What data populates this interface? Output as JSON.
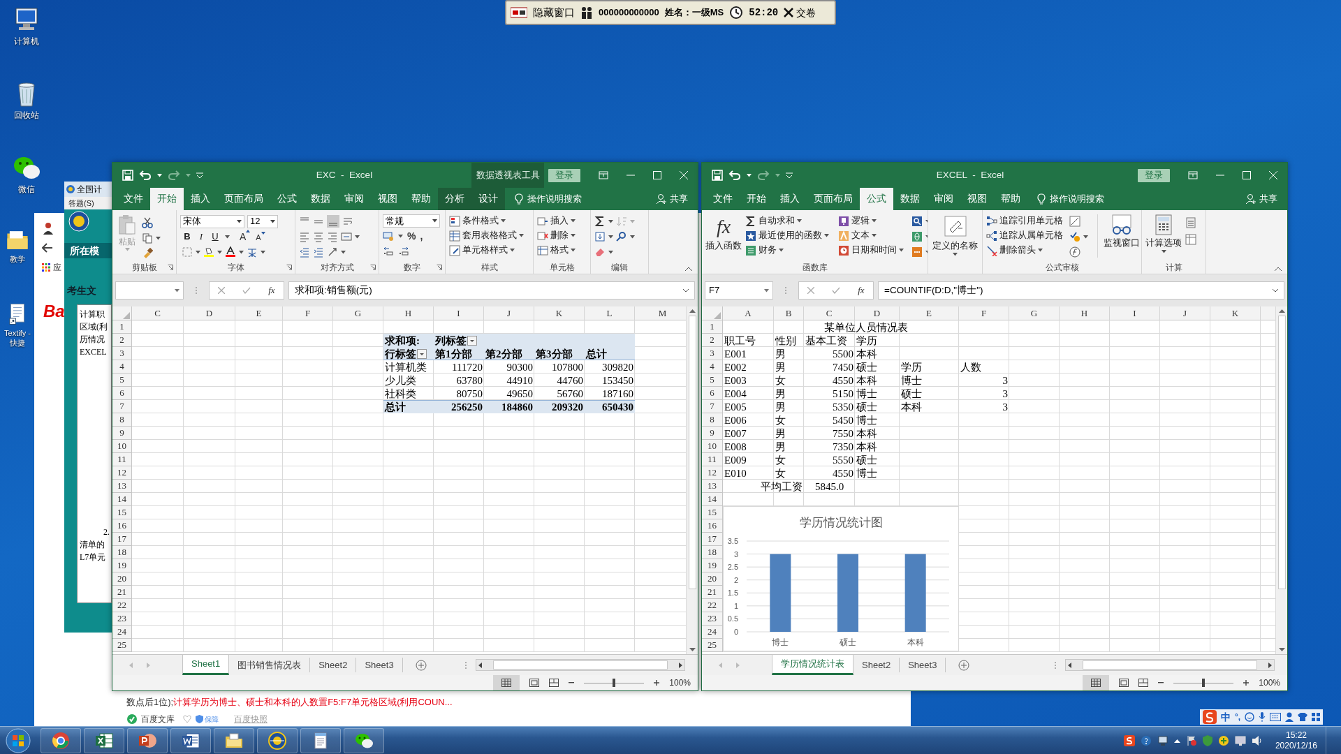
{
  "exam_bar": {
    "hide_window": "隐藏窗口",
    "exam_id": "000000000000",
    "candidate": "姓名：一级MS",
    "timer": "52:20",
    "submit": "交卷"
  },
  "desktop_icons": [
    {
      "kind": "computer",
      "label": "计算机"
    },
    {
      "kind": "recycle_bin",
      "label": "回收站"
    },
    {
      "kind": "wechat",
      "label": "微信"
    },
    {
      "kind": "folder",
      "label": "教学"
    },
    {
      "kind": "document",
      "label": "Textify - 快捷"
    }
  ],
  "browser": {
    "app_label": "应",
    "logo": "Ba",
    "note_prefix": "数点后1位);",
    "note_highlight": "计算学历为博士、硕士和本科的人数置F5:F7单元格区域(利用COUN...",
    "source": "百度文库",
    "badge": "保障",
    "snapshot": "百度快照"
  },
  "exam_window": {
    "title": "全国计",
    "menu": "答题(S)",
    "module": "所在模",
    "folder_label": "考生文",
    "lines": [
      "计算职",
      "区域(利",
      "历情况",
      "EXCEL"
    ],
    "item_number": "2.",
    "lines_2": [
      "清单的",
      "L7单元"
    ]
  },
  "excel_windows": [
    {
      "title": "EXC  -  Excel",
      "context_title": "数据透视表工具",
      "login": "登录",
      "tabs": [
        {
          "label": "文件",
          "selected": false,
          "contextual": false
        },
        {
          "label": "开始",
          "selected": true,
          "contextual": false
        },
        {
          "label": "插入",
          "selected": false,
          "contextual": false
        },
        {
          "label": "页面布局",
          "selected": false,
          "contextual": false
        },
        {
          "label": "公式",
          "selected": false,
          "contextual": false
        },
        {
          "label": "数据",
          "selected": false,
          "contextual": false
        },
        {
          "label": "审阅",
          "selected": false,
          "contextual": false
        },
        {
          "label": "视图",
          "selected": false,
          "contextual": false
        },
        {
          "label": "帮助",
          "selected": false,
          "contextual": false
        },
        {
          "label": "分析",
          "selected": false,
          "contextual": true
        },
        {
          "label": "设计",
          "selected": false,
          "contextual": true
        }
      ],
      "search": "操作说明搜索",
      "share": "共享",
      "ribbon": [
        {
          "kind": "clipboard",
          "label": "剪贴板",
          "paste": "粘贴"
        },
        {
          "kind": "font",
          "label": "字体",
          "font": "宋体",
          "size": "12",
          "buttons": [
            "B",
            "I",
            "U"
          ],
          "size_buttons": [
            "A",
            "A"
          ]
        },
        {
          "kind": "alignment",
          "label": "对齐方式"
        },
        {
          "kind": "number",
          "label": "数字",
          "format": "常规",
          "buttons": [
            "%",
            ","
          ]
        },
        {
          "kind": "styles",
          "label": "样式",
          "items": [
            "条件格式",
            "套用表格格式",
            "单元格样式"
          ]
        },
        {
          "kind": "cells",
          "label": "单元格",
          "items": [
            "插入",
            "删除",
            "格式"
          ]
        },
        {
          "kind": "editing",
          "label": "编辑"
        }
      ],
      "fx": "fx",
      "formula": "求和项:销售额(元)",
      "columns": [
        "C",
        "D",
        "E",
        "F",
        "G",
        "H",
        "I",
        "J",
        "K",
        "L",
        "M"
      ],
      "row_numbers": [
        "1",
        "2",
        "3",
        "4",
        "5",
        "6",
        "7",
        "8",
        "9",
        "10",
        "11",
        "12",
        "13",
        "14",
        "15",
        "16",
        "17",
        "18",
        "19",
        "20",
        "21",
        "22",
        "23",
        "24",
        "25"
      ],
      "pivot": {
        "title": "求和项:",
        "column_label": {
          "text": "列标签",
          "filter": true
        },
        "row_label": {
          "text": "行标签",
          "filter": true
        },
        "columns": [
          "第1分部",
          "第2分部",
          "第3分部",
          "总计"
        ],
        "rows": [
          {
            "label": "计算机类",
            "values": [
              "111720",
              "90300",
              "107800",
              "309820"
            ]
          },
          {
            "label": "少儿类",
            "values": [
              "63780",
              "44910",
              "44760",
              "153450"
            ]
          },
          {
            "label": "社科类",
            "values": [
              "80750",
              "49650",
              "56760",
              "187160"
            ]
          }
        ],
        "total": {
          "label": "总计",
          "values": [
            "256250",
            "184860",
            "209320",
            "650430"
          ]
        }
      },
      "sheets": [
        {
          "label": "Sheet1",
          "selected": true
        },
        {
          "label": "图书销售情况表",
          "selected": false
        },
        {
          "label": "Sheet2",
          "selected": false
        },
        {
          "label": "Sheet3",
          "selected": false
        }
      ],
      "zoom": "100%",
      "zoom_slider": {
        "level": 0.5
      }
    },
    {
      "title": "EXCEL  -  Excel",
      "login": "登录",
      "tabs": [
        {
          "label": "文件",
          "selected": false,
          "contextual": false
        },
        {
          "label": "开始",
          "selected": false,
          "contextual": false
        },
        {
          "label": "插入",
          "selected": false,
          "contextual": false
        },
        {
          "label": "页面布局",
          "selected": false,
          "contextual": false
        },
        {
          "label": "公式",
          "selected": true,
          "contextual": false
        },
        {
          "label": "数据",
          "selected": false,
          "contextual": false
        },
        {
          "label": "审阅",
          "selected": false,
          "contextual": false
        },
        {
          "label": "视图",
          "selected": false,
          "contextual": false
        },
        {
          "label": "帮助",
          "selected": false,
          "contextual": false
        }
      ],
      "search": "操作说明搜索",
      "share": "共享",
      "ribbon": [
        {
          "kind": "function_library",
          "label": "函数库",
          "insert_glyph": "fx",
          "insert": "插入函数",
          "items": [
            "自动求和",
            "最近使用的函数",
            "财务",
            "逻辑",
            "文本",
            "日期和时间"
          ]
        },
        {
          "kind": "defined_names",
          "items": [
            "定义的名称"
          ]
        },
        {
          "kind": "formula_auditing",
          "label": "公式审核",
          "items": [
            "追踪引用单元格",
            "追踪从属单元格",
            "删除箭头"
          ],
          "watch": "监视窗口"
        },
        {
          "kind": "calculation",
          "label": "计算",
          "items": [
            "计算选项"
          ]
        }
      ],
      "name_box": "F7",
      "fx": "fx",
      "formula": "=COUNTIF(D:D,\"博士\")",
      "columns": [
        "A",
        "B",
        "C",
        "D",
        "E",
        "F",
        "G",
        "H",
        "I",
        "J",
        "K"
      ],
      "row_numbers": [
        "1",
        "2",
        "3",
        "4",
        "5",
        "6",
        "7",
        "8",
        "9",
        "10",
        "11",
        "12",
        "13",
        "14",
        "15",
        "16",
        "17",
        "18",
        "19",
        "20",
        "21",
        "22",
        "23",
        "24",
        "25"
      ],
      "table": {
        "title": "某单位人员情况表",
        "headers": [
          "职工号",
          "性别",
          "基本工资",
          "学历"
        ],
        "rows": [
          [
            "E001",
            "男",
            "5500",
            "本科"
          ],
          [
            "E002",
            "男",
            "7450",
            "硕士"
          ],
          [
            "E003",
            "女",
            "4550",
            "本科"
          ],
          [
            "E004",
            "男",
            "5150",
            "博士"
          ],
          [
            "E005",
            "男",
            "5350",
            "硕士"
          ],
          [
            "E006",
            "女",
            "5450",
            "博士"
          ],
          [
            "E007",
            "男",
            "7550",
            "本科"
          ],
          [
            "E008",
            "男",
            "7350",
            "本科"
          ],
          [
            "E009",
            "女",
            "5550",
            "硕士"
          ],
          [
            "E010",
            "女",
            "4550",
            "博士"
          ]
        ],
        "average": {
          "label": "平均工资",
          "value": "5845.0"
        }
      },
      "summary": {
        "headers": [
          "学历",
          "人数"
        ],
        "rows": [
          [
            "博士",
            "3"
          ],
          [
            "硕士",
            "3"
          ],
          [
            "本科",
            "3"
          ]
        ]
      },
      "chart": {
        "chart_data": {
          "type": "bar",
          "title": "学历情况统计图",
          "grid": true,
          "categories": [
            "博士",
            "硕士",
            "本科"
          ],
          "series": [
            {
              "color": "#4f81bd",
              "values": [
                3,
                3,
                3
              ]
            }
          ],
          "ylim": [
            0,
            3.5
          ],
          "yticks": [
            {
              "value": 0,
              "label": "0"
            },
            {
              "value": 0.5,
              "label": "0.5"
            },
            {
              "value": 1,
              "label": "1"
            },
            {
              "value": 1.5,
              "label": "1.5"
            },
            {
              "value": 2,
              "label": "2"
            },
            {
              "value": 2.5,
              "label": "2.5"
            },
            {
              "value": 3,
              "label": "3"
            },
            {
              "value": 3.5,
              "label": "3.5"
            }
          ]
        }
      },
      "sheets": [
        {
          "label": "学历情况统计表",
          "selected": true
        },
        {
          "label": "Sheet2",
          "selected": false
        },
        {
          "label": "Sheet3",
          "selected": false
        }
      ],
      "zoom": "100%",
      "zoom_slider": {
        "level": 0.5
      }
    }
  ],
  "taskbar": {
    "apps": [
      {
        "kind": "browser"
      },
      {
        "kind": "spreadsheet"
      },
      {
        "kind": "slides"
      },
      {
        "kind": "word"
      },
      {
        "kind": "files"
      },
      {
        "kind": "exam"
      },
      {
        "kind": "notepad"
      },
      {
        "kind": "chat"
      }
    ],
    "ime": "中",
    "punct": "°,",
    "time": "15:22",
    "date": "2020/12/16"
  }
}
